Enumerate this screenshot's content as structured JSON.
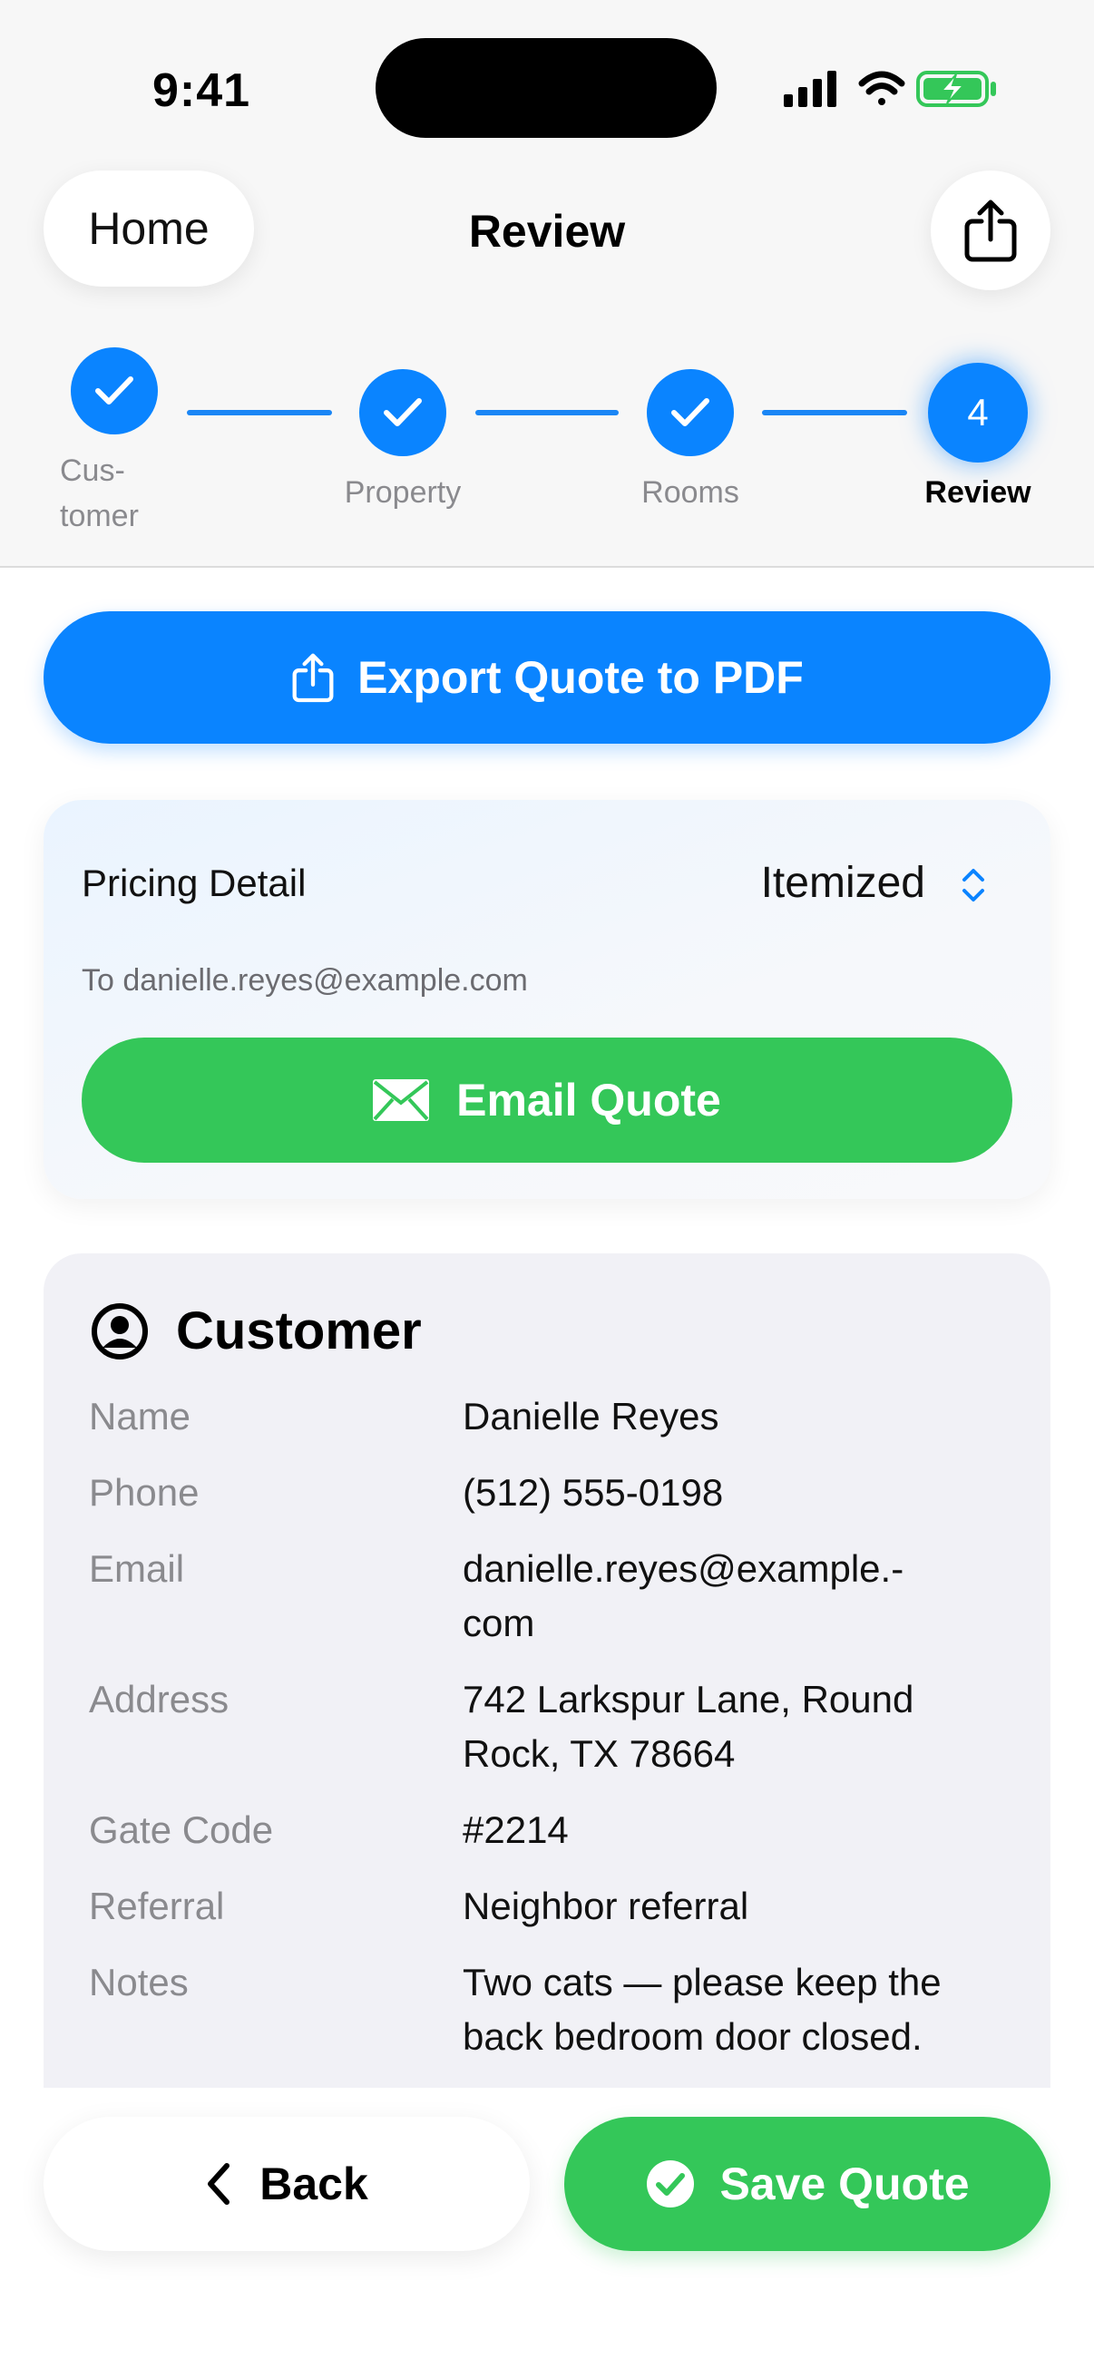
{
  "status_bar": {
    "time": "9:41"
  },
  "nav": {
    "home_label": "Home",
    "title": "Review"
  },
  "stepper": {
    "steps": [
      {
        "label_line1": "Cus-",
        "label_line2": "tomer",
        "state": "done"
      },
      {
        "label": "Property",
        "state": "done"
      },
      {
        "label": "Rooms",
        "state": "done"
      },
      {
        "number": "4",
        "label": "Review",
        "state": "active"
      }
    ]
  },
  "actions": {
    "export_label": "Export Quote to PDF"
  },
  "pricing": {
    "label": "Pricing Detail",
    "value": "Itemized",
    "email_to": "To danielle.reyes@example.com",
    "email_button": "Email Quote"
  },
  "customer": {
    "title": "Customer",
    "fields": [
      {
        "key": "Name",
        "value": "Danielle Reyes"
      },
      {
        "key": "Phone",
        "value": "(512) 555-0198"
      },
      {
        "key": "Email",
        "value_line1": "danielle.reyes@example.-",
        "value_line2": "com"
      },
      {
        "key": "Address",
        "value_line1": "742 Larkspur Lane, Round",
        "value_line2": "Rock, TX 78664"
      },
      {
        "key": "Gate Code",
        "value": "#2214"
      },
      {
        "key": "Referral",
        "value": "Neighbor referral"
      },
      {
        "key": "Notes",
        "value_line1": "Two cats — please keep the",
        "value_line2": "back bedroom door closed."
      }
    ]
  },
  "bottom": {
    "back_label": "Back",
    "save_label": "Save Quote"
  },
  "colors": {
    "accent": "#0a84ff",
    "success": "#34c759",
    "card": "#f1f1f6"
  }
}
